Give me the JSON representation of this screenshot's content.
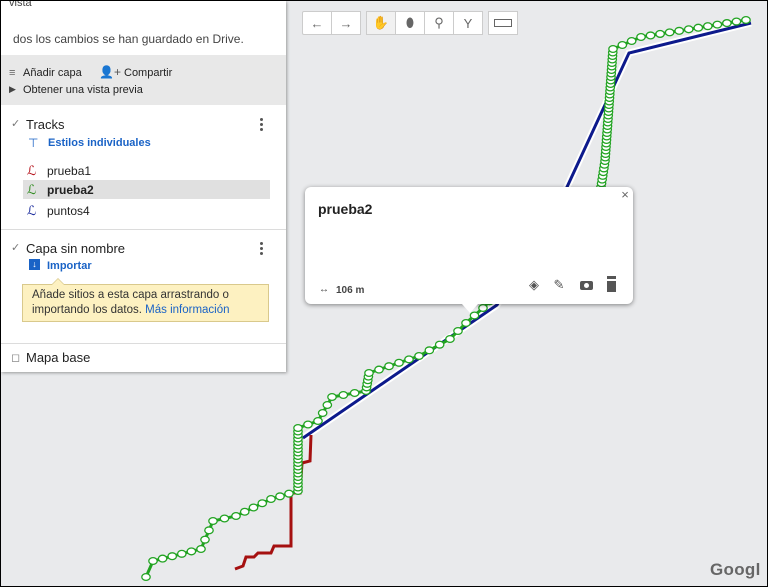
{
  "panel": {
    "title_partial": "vista",
    "saved_status": "dos los cambios se han guardado en Drive.",
    "add_layer": "Añadir capa",
    "share": "Compartir",
    "preview": "Obtener una vista previa",
    "layers": [
      {
        "name": "Tracks",
        "style_link": "Estilos individuales",
        "items": [
          {
            "label": "prueba1",
            "color": "#b5121b",
            "selected": false
          },
          {
            "label": "prueba2",
            "color": "#2e8b1e",
            "selected": true
          },
          {
            "label": "puntos4",
            "color": "#1a2b9c",
            "selected": false
          }
        ]
      },
      {
        "name": "Capa sin nombre",
        "import_link": "Importar",
        "tip_text": "Añade sitios a esta capa arrastrando o importando los datos.",
        "tip_link": "Más información"
      }
    ],
    "basemap": "Mapa base"
  },
  "toolbar": {
    "tools": [
      "undo-icon",
      "redo-icon",
      "hand-icon",
      "marker-icon",
      "draw-line-icon",
      "directions-icon",
      "ruler-icon"
    ],
    "active": "hand-icon"
  },
  "popup": {
    "title": "prueba2",
    "distance": "106 m",
    "actions": [
      "paint-bucket-icon",
      "pencil-icon",
      "camera-icon",
      "trash-icon"
    ]
  },
  "map": {
    "attribution": "Googl",
    "colors": {
      "green_track": "#22a322",
      "blue_track": "#0d1a8c",
      "red_track": "#a51010",
      "map_bg": "#e9eaec"
    }
  }
}
